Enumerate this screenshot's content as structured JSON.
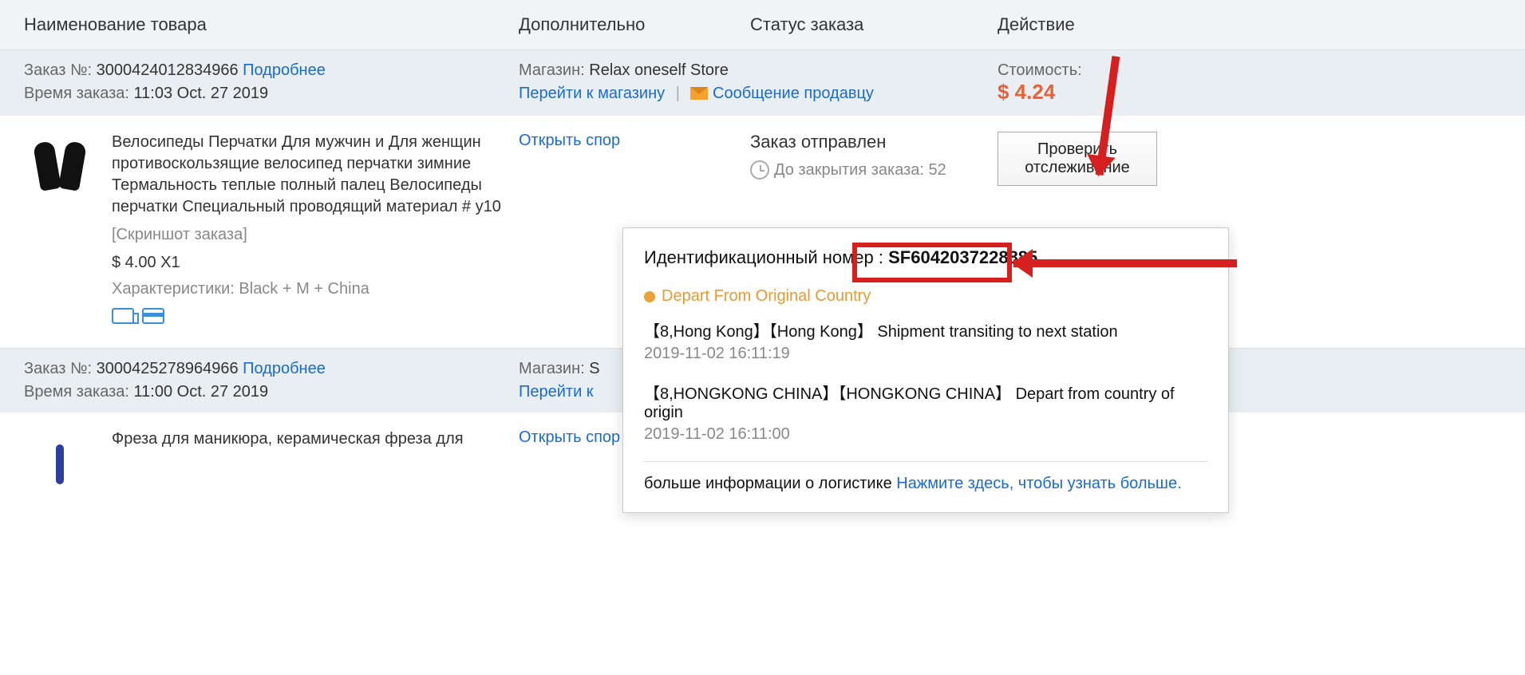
{
  "headers": {
    "name": "Наименование товара",
    "extra": "Дополнительно",
    "status": "Статус заказа",
    "action": "Действие"
  },
  "orders": [
    {
      "order_label": "Заказ №:",
      "order_number": "3000424012834966",
      "details_link": "Подробнее",
      "time_label": "Время заказа:",
      "time_value": "11:03 Oct. 27 2019",
      "store_label": "Магазин:",
      "store_name": "Relax oneself Store",
      "store_link": "Перейти к магазину",
      "message_seller": "Сообщение продавцу",
      "cost_label": "Стоимость:",
      "cost_value": "$ 4.24",
      "product_title": "Велосипеды Перчатки Для мужчин и Для женщин противоскользящие велосипед перчатки зимние Термальность теплые полный палец Велосипеды перчатки Специальный проводящий материал # y10",
      "screenshot_label": "[Скриншот заказа]",
      "price_qty": "$ 4.00 X1",
      "spec_label": "Характеристики: Black + M + China",
      "open_dispute": "Открыть спор",
      "ship_status": "Заказ отправлен",
      "close_left": "До закрытия заказа: 52",
      "track_button": "Проверить отслеживание"
    },
    {
      "order_label": "Заказ №:",
      "order_number": "3000425278964966",
      "details_link": "Подробнее",
      "time_label": "Время заказа:",
      "time_value": "11:00 Oct. 27 2019",
      "store_label": "Магазин:",
      "store_partial": "S",
      "store_link": "Перейти к",
      "product_title": "Фреза для маникюра, керамическая фреза для",
      "open_dispute": "Открыть спор"
    }
  ],
  "tracking": {
    "id_label": "Идентификационный номер :",
    "id_value": "SF6042037228885",
    "status": "Depart From Original Country",
    "events": [
      {
        "text": "【8,Hong Kong】【Hong Kong】 Shipment transiting to next station",
        "time": "2019-11-02 16:11:19"
      },
      {
        "text": "【8,HONGKONG CHINA】【HONGKONG CHINA】 Depart from country of origin",
        "time": "2019-11-02 16:11:00"
      }
    ],
    "more_label": "больше информации о логистике",
    "more_link": "Нажмите здесь, чтобы узнать больше."
  }
}
